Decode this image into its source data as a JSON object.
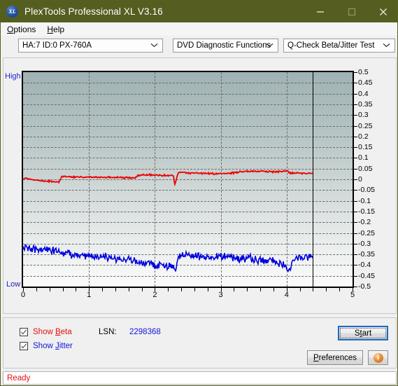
{
  "window": {
    "title": "PlexTools Professional XL V3.16",
    "icon": "xl-app-icon",
    "icon_text": "XL",
    "titlebar_color": "#555e20",
    "minimize_label": "Minimize",
    "maximize_label": "Maximize",
    "close_label": "Close"
  },
  "menubar": {
    "items": [
      {
        "label": "Options",
        "accel": "O"
      },
      {
        "label": "Help",
        "accel": "H"
      }
    ]
  },
  "toolbar": {
    "drive_select": {
      "value": "HA:7 ID:0  PX-760A"
    },
    "function_select": {
      "value": "DVD Diagnostic Functions"
    },
    "test_select": {
      "value": "Q-Check Beta/Jitter Test"
    }
  },
  "controls": {
    "show_beta": {
      "label_pre": "Show ",
      "accel": "B",
      "label_post": "eta",
      "checked": true,
      "color": "#e01010"
    },
    "show_jitter": {
      "label_pre": "Show ",
      "accel": "J",
      "label_post": "itter",
      "checked": true,
      "color": "#1414dc"
    },
    "lsn_label": "LSN:",
    "lsn_value": "2298368",
    "start_button": {
      "label_pre": "S",
      "accel": "t",
      "label_post": "art",
      "full": "Start"
    },
    "preferences_button": {
      "accel": "P",
      "label_post": "references",
      "full": "Preferences"
    },
    "info_button": {
      "label": "i",
      "title": "Info"
    }
  },
  "status": {
    "text": "Ready",
    "color": "#e01010"
  },
  "chart_data": {
    "type": "line",
    "title": "Q-Check Beta/Jitter Test",
    "xlabel": "",
    "ylabel": "",
    "xlim": [
      0,
      5
    ],
    "ylim": [
      -0.5,
      0.5
    ],
    "grid": true,
    "legend_position": "external-checkboxes",
    "axis_labels": {
      "top_left": "High",
      "bottom_left": "Low"
    },
    "xticks": [
      0,
      1,
      2,
      3,
      4,
      5
    ],
    "xticklabels": [
      "0",
      "1",
      "2",
      "3",
      "4",
      "5"
    ],
    "yticks": [
      0.5,
      0.45,
      0.4,
      0.35,
      0.3,
      0.25,
      0.2,
      0.15,
      0.1,
      0.05,
      0,
      -0.05,
      -0.1,
      -0.15,
      -0.2,
      -0.25,
      -0.3,
      -0.35,
      -0.4,
      -0.45,
      -0.5
    ],
    "yticklabels": [
      "0.5",
      "0.45",
      "0.4",
      "0.35",
      "0.3",
      "0.25",
      "0.2",
      "0.15",
      "0.1",
      "0.05",
      "0",
      "-0.05",
      "-0.1",
      "-0.15",
      "-0.2",
      "-0.25",
      "-0.3",
      "-0.35",
      "-0.4",
      "-0.45",
      "-0.5"
    ],
    "cursor_x": 4.4,
    "data_end_x": 4.4,
    "series": [
      {
        "name": "Beta",
        "color": "#ee0000",
        "x": [
          0.0,
          0.1,
          0.2,
          0.3,
          0.4,
          0.5,
          0.55,
          0.58,
          0.62,
          0.7,
          0.8,
          0.9,
          1.0,
          1.1,
          1.2,
          1.3,
          1.4,
          1.5,
          1.6,
          1.7,
          1.75,
          1.8,
          1.9,
          2.0,
          2.1,
          2.2,
          2.28,
          2.3,
          2.32,
          2.34,
          2.36,
          2.4,
          2.5,
          2.6,
          2.7,
          2.8,
          2.9,
          3.0,
          3.1,
          3.2,
          3.3,
          3.4,
          3.5,
          3.6,
          3.7,
          3.8,
          3.9,
          4.0,
          4.05,
          4.1,
          4.2,
          4.3,
          4.4
        ],
        "y": [
          0.005,
          0.0,
          -0.004,
          -0.008,
          -0.01,
          -0.012,
          -0.012,
          0.01,
          0.012,
          0.012,
          0.011,
          0.011,
          0.01,
          0.01,
          0.009,
          0.009,
          0.008,
          0.008,
          0.007,
          0.007,
          0.018,
          0.02,
          0.02,
          0.02,
          0.02,
          0.019,
          0.019,
          -0.025,
          -0.01,
          0.02,
          0.03,
          0.032,
          0.03,
          0.029,
          0.028,
          0.028,
          0.027,
          0.027,
          0.028,
          0.03,
          0.035,
          0.037,
          0.038,
          0.038,
          0.037,
          0.036,
          0.036,
          0.042,
          0.03,
          0.028,
          0.03,
          0.028,
          0.028
        ],
        "noise": 0.004
      },
      {
        "name": "Jitter",
        "color": "#0000e0",
        "x": [
          0.0,
          0.1,
          0.2,
          0.3,
          0.4,
          0.5,
          0.55,
          0.58,
          0.62,
          0.7,
          0.8,
          0.9,
          1.0,
          1.1,
          1.2,
          1.3,
          1.4,
          1.5,
          1.6,
          1.7,
          1.8,
          1.9,
          2.0,
          2.1,
          2.15,
          2.2,
          2.25,
          2.28,
          2.3,
          2.32,
          2.34,
          2.36,
          2.4,
          2.45,
          2.5,
          2.6,
          2.7,
          2.8,
          2.9,
          3.0,
          3.1,
          3.2,
          3.3,
          3.4,
          3.5,
          3.6,
          3.7,
          3.8,
          3.9,
          4.0,
          4.05,
          4.1,
          4.2,
          4.3,
          4.4
        ],
        "y": [
          -0.32,
          -0.322,
          -0.325,
          -0.328,
          -0.33,
          -0.332,
          -0.333,
          -0.348,
          -0.35,
          -0.352,
          -0.354,
          -0.356,
          -0.358,
          -0.36,
          -0.362,
          -0.365,
          -0.368,
          -0.372,
          -0.376,
          -0.382,
          -0.388,
          -0.394,
          -0.398,
          -0.402,
          -0.405,
          -0.405,
          -0.404,
          -0.402,
          -0.44,
          -0.42,
          -0.39,
          -0.362,
          -0.358,
          -0.356,
          -0.356,
          -0.358,
          -0.36,
          -0.362,
          -0.365,
          -0.362,
          -0.36,
          -0.362,
          -0.366,
          -0.37,
          -0.374,
          -0.378,
          -0.38,
          -0.382,
          -0.392,
          -0.402,
          -0.425,
          -0.38,
          -0.362,
          -0.36,
          -0.362
        ],
        "noise": 0.018
      }
    ]
  }
}
